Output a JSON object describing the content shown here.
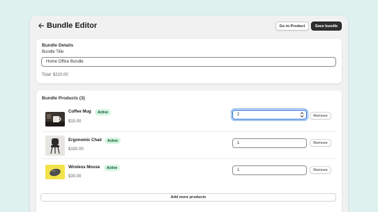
{
  "header": {
    "title": "Bundle Editor",
    "go_to_product_label": "Go to Product",
    "save_label": "Save bundle"
  },
  "details": {
    "section_title": "Bundle Details",
    "title_label": "Bundle Title",
    "title_value": "Home Office Bundle",
    "total_text": "Total: $210.00"
  },
  "products": {
    "section_title": "Bundle Products (3)",
    "items": [
      {
        "name": "Coffee Mug",
        "status": "Active",
        "price": "$15.00",
        "quantity": "2",
        "remove_label": "Remove",
        "image_icon": "coffee-mug-photo"
      },
      {
        "name": "Ergonomic Chair",
        "status": "Active",
        "price": "$150.00",
        "quantity": "1",
        "remove_label": "Remove",
        "image_icon": "office-chair-photo"
      },
      {
        "name": "Wireless Mouse",
        "status": "Active",
        "price": "$30.00",
        "quantity": "1",
        "remove_label": "Remove",
        "image_icon": "mouse-photo"
      }
    ],
    "add_more_label": "Add more products"
  },
  "colors": {
    "page_background": "#dff1ef",
    "primary_button": "#303030",
    "badge_background": "#d4f5de",
    "badge_text": "#0c5132",
    "focus_ring": "#005bd3"
  }
}
